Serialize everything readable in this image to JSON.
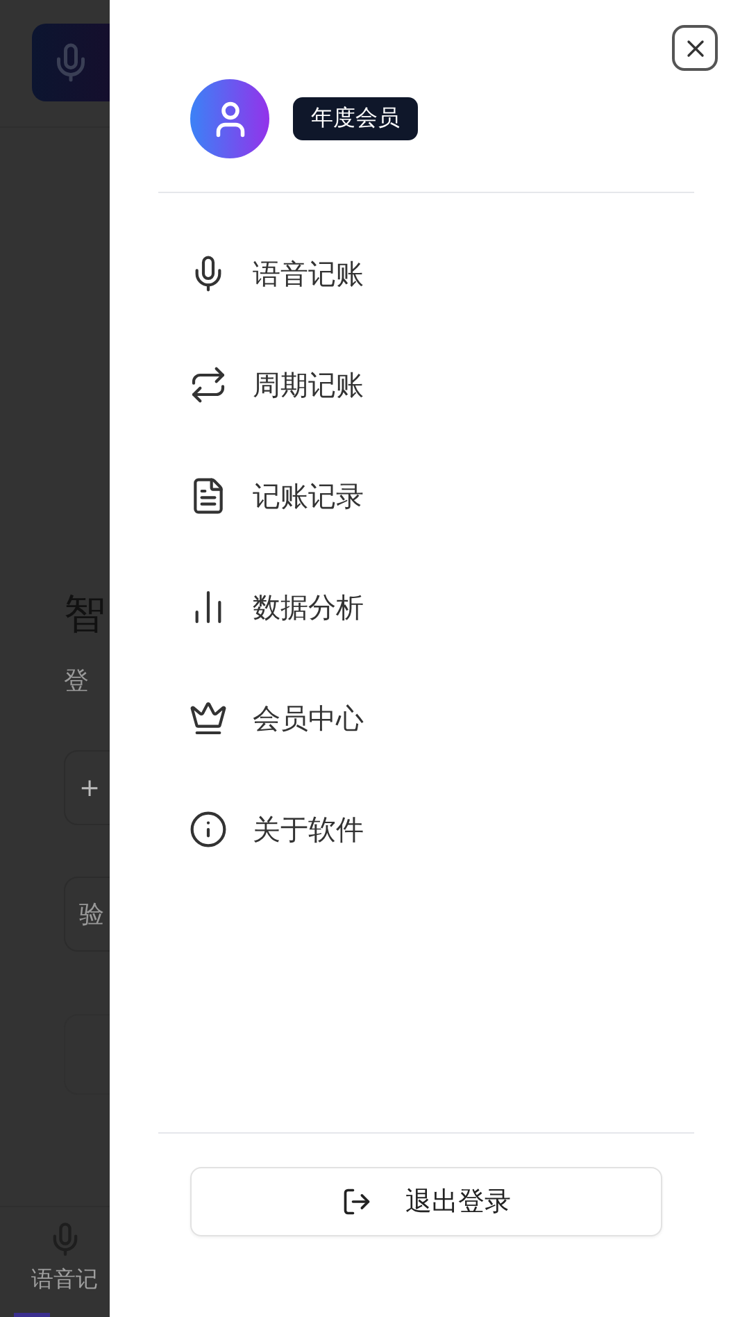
{
  "background_page": {
    "title": "智",
    "subtitle": "登",
    "phone_field": "+",
    "code_field": "验",
    "nav_label": "语音记"
  },
  "drawer": {
    "badge": "年度会员",
    "menu": [
      {
        "label": "语音记账"
      },
      {
        "label": "周期记账"
      },
      {
        "label": "记账记录"
      },
      {
        "label": "数据分析"
      },
      {
        "label": "会员中心"
      },
      {
        "label": "关于软件"
      }
    ],
    "logout": "退出登录"
  }
}
